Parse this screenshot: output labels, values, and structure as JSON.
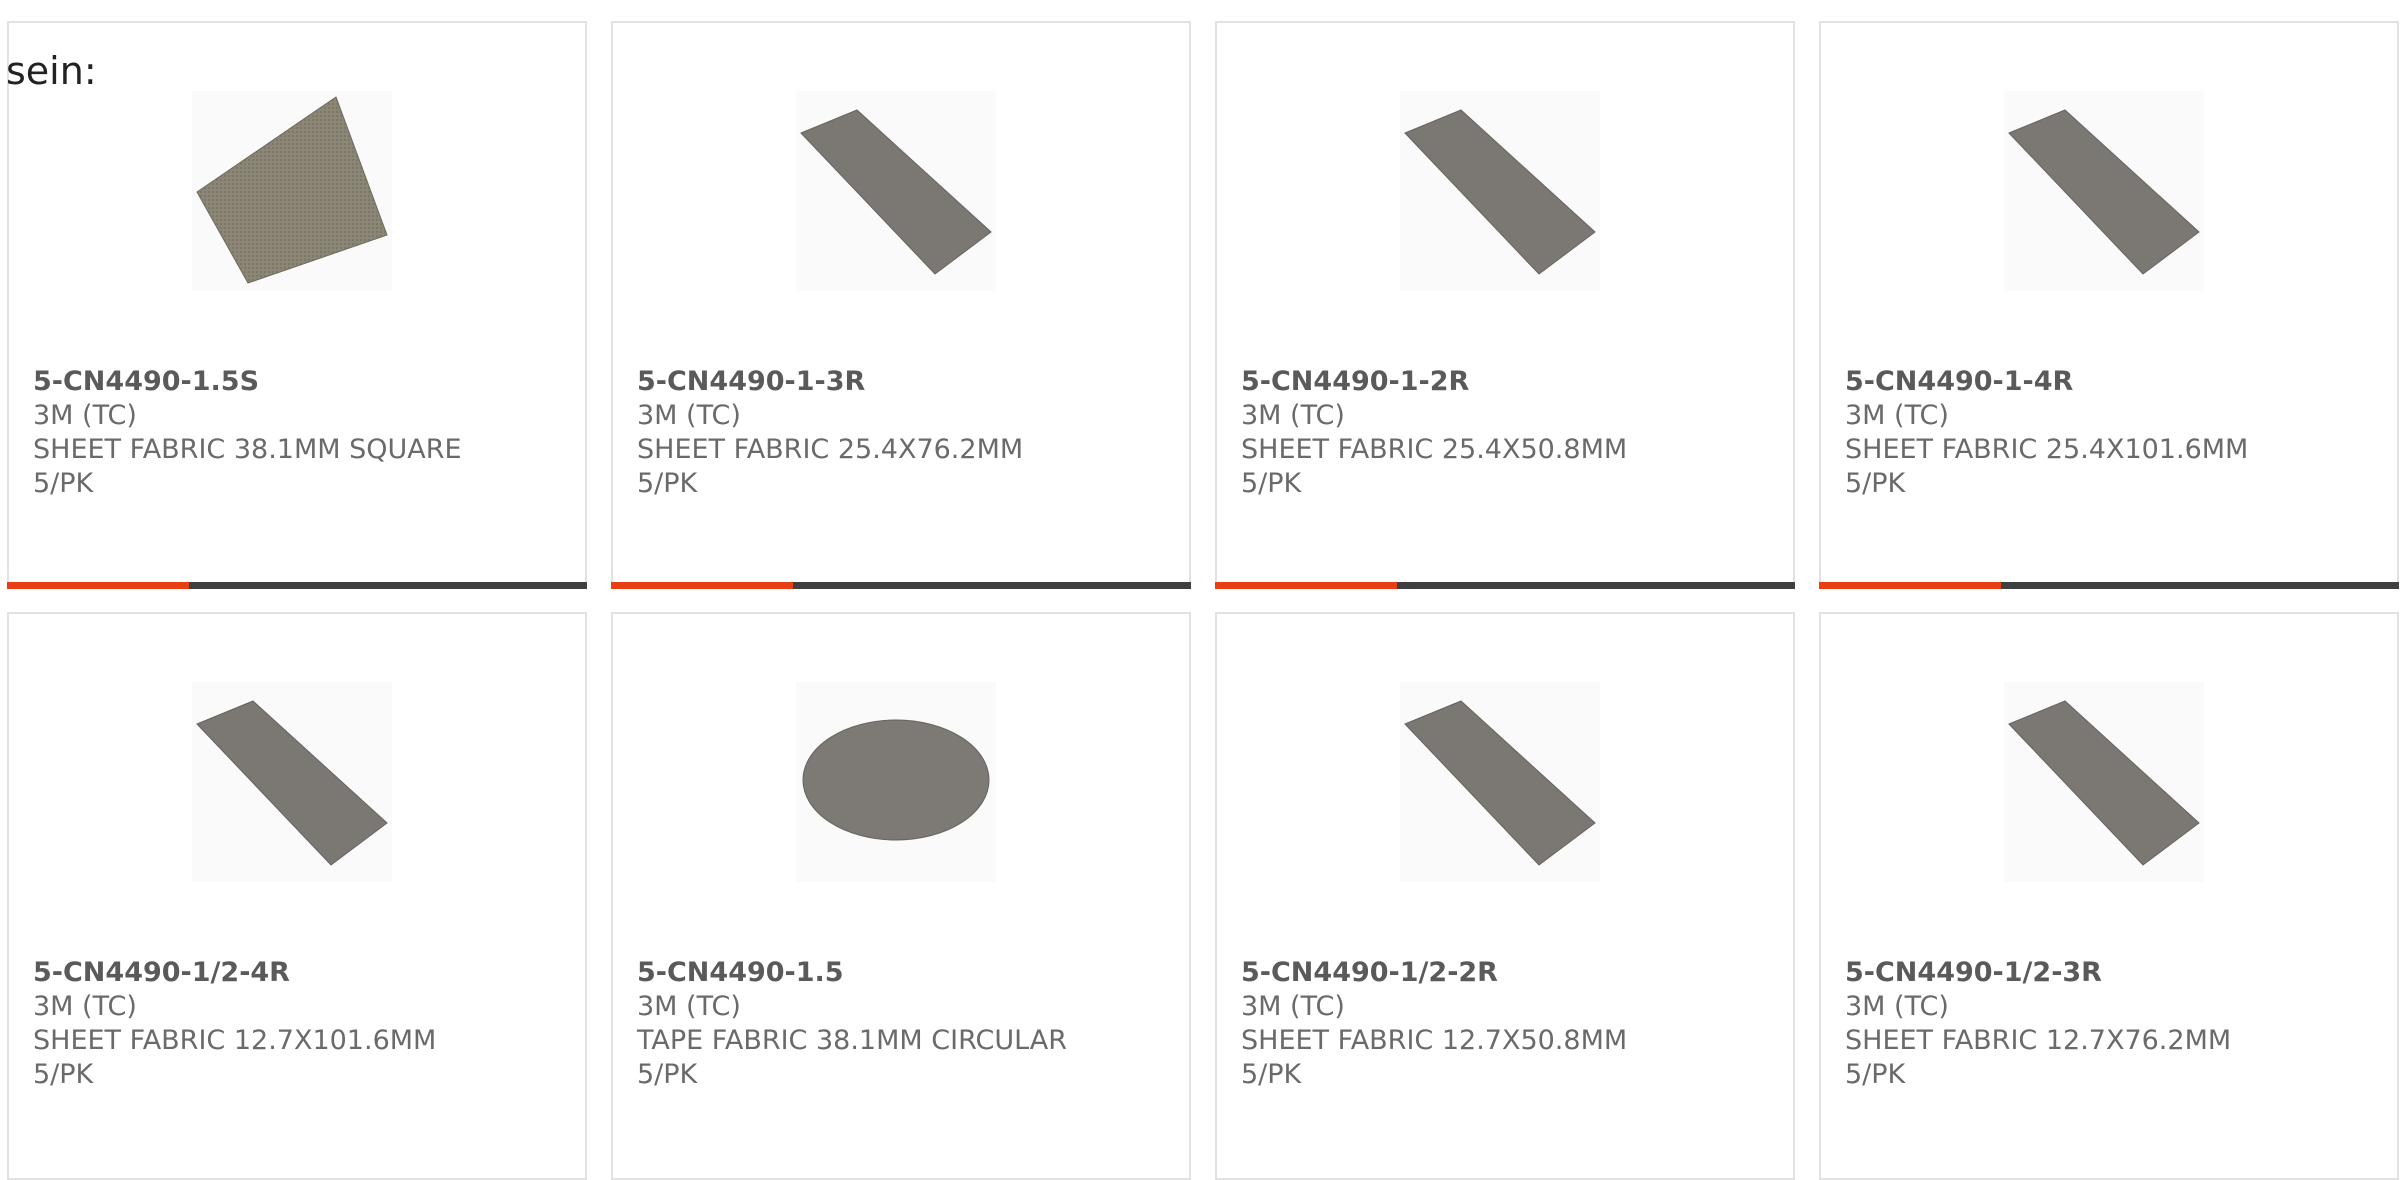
{
  "intro_text": "sein:",
  "colors": {
    "accent": "#e83e14",
    "bar": "#3f3f3f",
    "border": "#e2e2e2",
    "text": "#6a6a6a"
  },
  "products": [
    {
      "part_number": "5-CN4490-1.5S",
      "brand": "3M (TC)",
      "description": "SHEET FABRIC 38.1MM SQUARE",
      "pack": "5/PK",
      "image": "square-fabric-sheet"
    },
    {
      "part_number": "5-CN4490-1-3R",
      "brand": "3M (TC)",
      "description": "SHEET FABRIC 25.4X76.2MM",
      "pack": "5/PK",
      "image": "strip-fabric-sheet"
    },
    {
      "part_number": "5-CN4490-1-2R",
      "brand": "3M (TC)",
      "description": "SHEET FABRIC 25.4X50.8MM",
      "pack": "5/PK",
      "image": "strip-fabric-sheet"
    },
    {
      "part_number": "5-CN4490-1-4R",
      "brand": "3M (TC)",
      "description": "SHEET FABRIC 25.4X101.6MM",
      "pack": "5/PK",
      "image": "strip-fabric-sheet"
    },
    {
      "part_number": "5-CN4490-1/2-4R",
      "brand": "3M (TC)",
      "description": "SHEET FABRIC 12.7X101.6MM",
      "pack": "5/PK",
      "image": "strip-fabric-sheet"
    },
    {
      "part_number": "5-CN4490-1.5",
      "brand": "3M (TC)",
      "description": "TAPE FABRIC 38.1MM CIRCULAR",
      "pack": "5/PK",
      "image": "circular-fabric-tape"
    },
    {
      "part_number": "5-CN4490-1/2-2R",
      "brand": "3M (TC)",
      "description": "SHEET FABRIC 12.7X50.8MM",
      "pack": "5/PK",
      "image": "strip-fabric-sheet"
    },
    {
      "part_number": "5-CN4490-1/2-3R",
      "brand": "3M (TC)",
      "description": "SHEET FABRIC 12.7X76.2MM",
      "pack": "5/PK",
      "image": "strip-fabric-sheet"
    }
  ]
}
